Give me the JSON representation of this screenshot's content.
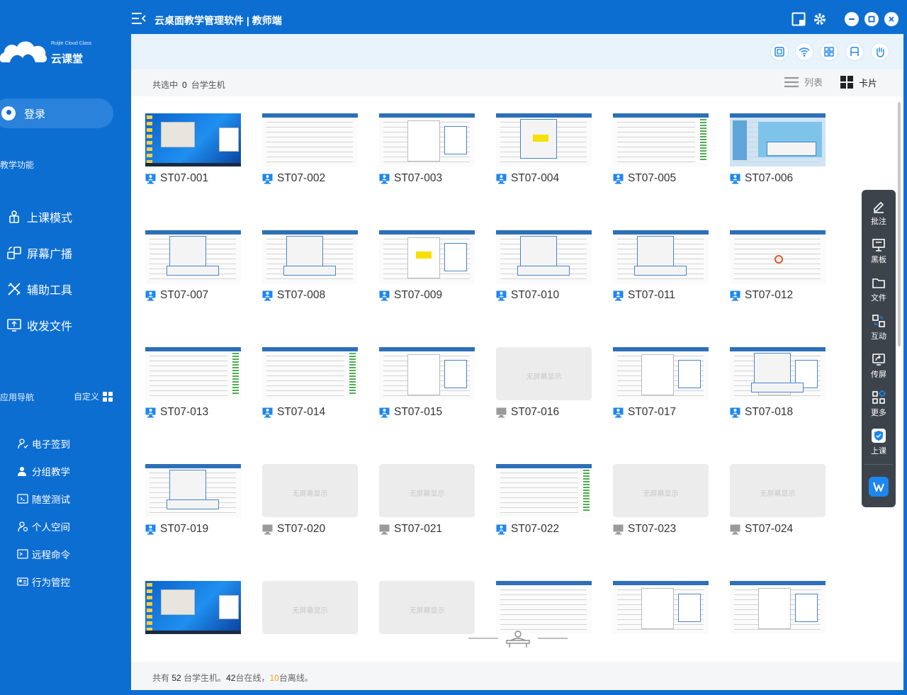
{
  "window": {
    "title": "云桌面教学管理软件 | 教师端"
  },
  "brand": {
    "small_text": "Ruijie Cloud Class",
    "name": "云课堂"
  },
  "sidebar": {
    "login_label": "登录",
    "teaching_section": "教学功能",
    "main_items": [
      {
        "label": "上课模式",
        "icon": "teacher-icon"
      },
      {
        "label": "屏幕广播",
        "icon": "broadcast-icon"
      },
      {
        "label": "辅助工具",
        "icon": "tools-icon"
      },
      {
        "label": "收发文件",
        "icon": "file-transfer-icon"
      }
    ],
    "app_nav_section": "应用导航",
    "customize_label": "自定义",
    "app_items": [
      {
        "label": "电子签到",
        "icon": "sign-in-icon"
      },
      {
        "label": "分组教学",
        "icon": "group-icon"
      },
      {
        "label": "随堂测试",
        "icon": "quiz-icon"
      },
      {
        "label": "个人空间",
        "icon": "personal-space-icon"
      },
      {
        "label": "远程命令",
        "icon": "terminal-icon"
      },
      {
        "label": "行为管控",
        "icon": "control-icon"
      }
    ]
  },
  "selection_bar": {
    "prefix": "共选中",
    "count": "0",
    "suffix": "台学生机",
    "list_label": "列表",
    "card_label": "卡片",
    "active_view": "card"
  },
  "students": [
    {
      "name": "ST07-001",
      "online": true,
      "screen": "desktop"
    },
    {
      "name": "ST07-002",
      "online": true,
      "screen": "sheet"
    },
    {
      "name": "ST07-003",
      "online": true,
      "screen": "doc"
    },
    {
      "name": "ST07-004",
      "online": true,
      "screen": "dialog-yellow"
    },
    {
      "name": "ST07-005",
      "online": true,
      "screen": "sheet-green"
    },
    {
      "name": "ST07-006",
      "online": true,
      "screen": "ppt"
    },
    {
      "name": "ST07-007",
      "online": true,
      "screen": "sheet-dialog"
    },
    {
      "name": "ST07-008",
      "online": true,
      "screen": "sheet-dialog"
    },
    {
      "name": "ST07-009",
      "online": true,
      "screen": "doc-yellow"
    },
    {
      "name": "ST07-010",
      "online": true,
      "screen": "sheet-dialog"
    },
    {
      "name": "ST07-011",
      "online": true,
      "screen": "sheet-dialog"
    },
    {
      "name": "ST07-012",
      "online": true,
      "screen": "sheet-circle"
    },
    {
      "name": "ST07-013",
      "online": true,
      "screen": "sheet-green"
    },
    {
      "name": "ST07-014",
      "online": true,
      "screen": "sheet-green"
    },
    {
      "name": "ST07-015",
      "online": true,
      "screen": "doc"
    },
    {
      "name": "ST07-016",
      "online": false,
      "screen": "none"
    },
    {
      "name": "ST07-017",
      "online": true,
      "screen": "doc"
    },
    {
      "name": "ST07-018",
      "online": true,
      "screen": "doc-dialog"
    },
    {
      "name": "ST07-019",
      "online": true,
      "screen": "sheet-dialog"
    },
    {
      "name": "ST07-020",
      "online": false,
      "screen": "none"
    },
    {
      "name": "ST07-021",
      "online": false,
      "screen": "none"
    },
    {
      "name": "ST07-022",
      "online": true,
      "screen": "sheet-green"
    },
    {
      "name": "ST07-023",
      "online": false,
      "screen": "none"
    },
    {
      "name": "ST07-024",
      "online": false,
      "screen": "none"
    },
    {
      "name": "",
      "online": true,
      "screen": "desktop"
    },
    {
      "name": "",
      "online": false,
      "screen": "none"
    },
    {
      "name": "",
      "online": false,
      "screen": "none"
    },
    {
      "name": "",
      "online": true,
      "screen": "sheet"
    },
    {
      "name": "",
      "online": true,
      "screen": "doc"
    },
    {
      "name": "",
      "online": true,
      "screen": "doc"
    }
  ],
  "no_screen_text": "无屏幕显示",
  "status": {
    "prefix": "共有",
    "total": "52",
    "total_suffix": "台学生机。",
    "online": "42",
    "online_suffix": "台在线，",
    "offline": "10",
    "offline_suffix": "台离线。"
  },
  "float_toolbar": [
    {
      "label": "批注",
      "icon": "annotate-icon"
    },
    {
      "label": "黑板",
      "icon": "blackboard-icon"
    },
    {
      "label": "文件",
      "icon": "folder-icon"
    },
    {
      "label": "互动",
      "icon": "interact-icon"
    },
    {
      "label": "传屏",
      "icon": "screen-share-icon"
    },
    {
      "label": "更多",
      "icon": "more-icon"
    },
    {
      "label": "上课",
      "icon": "class-start-icon"
    }
  ],
  "colors": {
    "brand_blue": "#0d6ed2",
    "offline_orange": "#f0a020",
    "float_bg": "#3d434b"
  }
}
